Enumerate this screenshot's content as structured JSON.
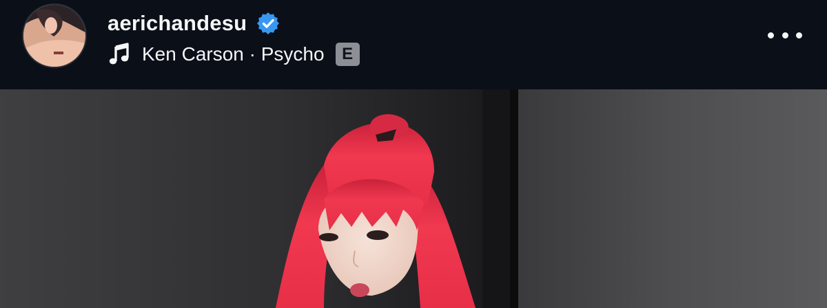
{
  "post": {
    "username": "aerichandesu",
    "verified": true,
    "music": {
      "track": "Ken Carson · Psycho",
      "explicit_badge": "E"
    }
  },
  "icons": {
    "verified": "verified-badge-icon",
    "music": "music-note-icon",
    "more": "more-options-icon"
  },
  "colors": {
    "background": "#0b0f17",
    "verified_blue": "#3897f0",
    "text": "#f5f6f8",
    "explicit_badge": "#8c8f95",
    "hair": "#e8344a"
  }
}
